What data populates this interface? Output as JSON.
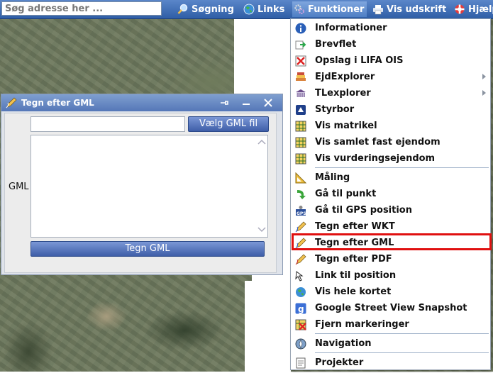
{
  "search": {
    "placeholder": "Søg adresse her ..."
  },
  "toolbar": {
    "soegning": "Søgning",
    "links": "Links",
    "funktioner": "Funktioner",
    "vis_udskrift": "Vis udskrift",
    "hjaelp": "Hjælp"
  },
  "menu": {
    "items": [
      {
        "label": "Informationer",
        "icon": "info-icon"
      },
      {
        "label": "Brevflet",
        "icon": "mail-merge-icon"
      },
      {
        "label": "Opslag i LIFA OIS",
        "icon": "lifa-ois-icon"
      },
      {
        "label": "EjdExplorer",
        "icon": "books-icon",
        "submenu": true
      },
      {
        "label": "TLexplorer",
        "icon": "building-icon",
        "submenu": true
      },
      {
        "label": "Styrbor",
        "icon": "steering-icon"
      },
      {
        "label": "Vis matrikel",
        "icon": "cadastre-icon"
      },
      {
        "label": "Vis samlet fast ejendom",
        "icon": "cadastre-icon"
      },
      {
        "label": "Vis vurderingsejendom",
        "icon": "cadastre-icon"
      },
      {
        "label": "Måling",
        "icon": "ruler-icon"
      },
      {
        "label": "Gå til punkt",
        "icon": "goto-point-icon"
      },
      {
        "label": "Gå til GPS position",
        "icon": "gps-icon"
      },
      {
        "label": "Tegn efter WKT",
        "icon": "draw-icon"
      },
      {
        "label": "Tegn efter GML",
        "icon": "draw-icon"
      },
      {
        "label": "Tegn efter PDF",
        "icon": "draw-icon"
      },
      {
        "label": "Link til position",
        "icon": "link-icon"
      },
      {
        "label": "Vis hele kortet",
        "icon": "globe-icon"
      },
      {
        "label": "Google Street View Snapshot",
        "icon": "google-icon"
      },
      {
        "label": "Fjern markeringer",
        "icon": "remove-markings-icon"
      },
      {
        "label": "Navigation",
        "icon": "compass-icon"
      },
      {
        "label": "Projekter",
        "icon": "projects-icon"
      }
    ]
  },
  "dialog": {
    "title": "Tegn efter GML",
    "gml_label": "GML",
    "choose_file": "Vælg GML fil",
    "draw_button": "Tegn GML",
    "file_value": "",
    "gml_text": ""
  },
  "colors": {
    "toolbar": "#3d6cb5",
    "highlight": "#e01010",
    "button": "#4a6bb4"
  }
}
